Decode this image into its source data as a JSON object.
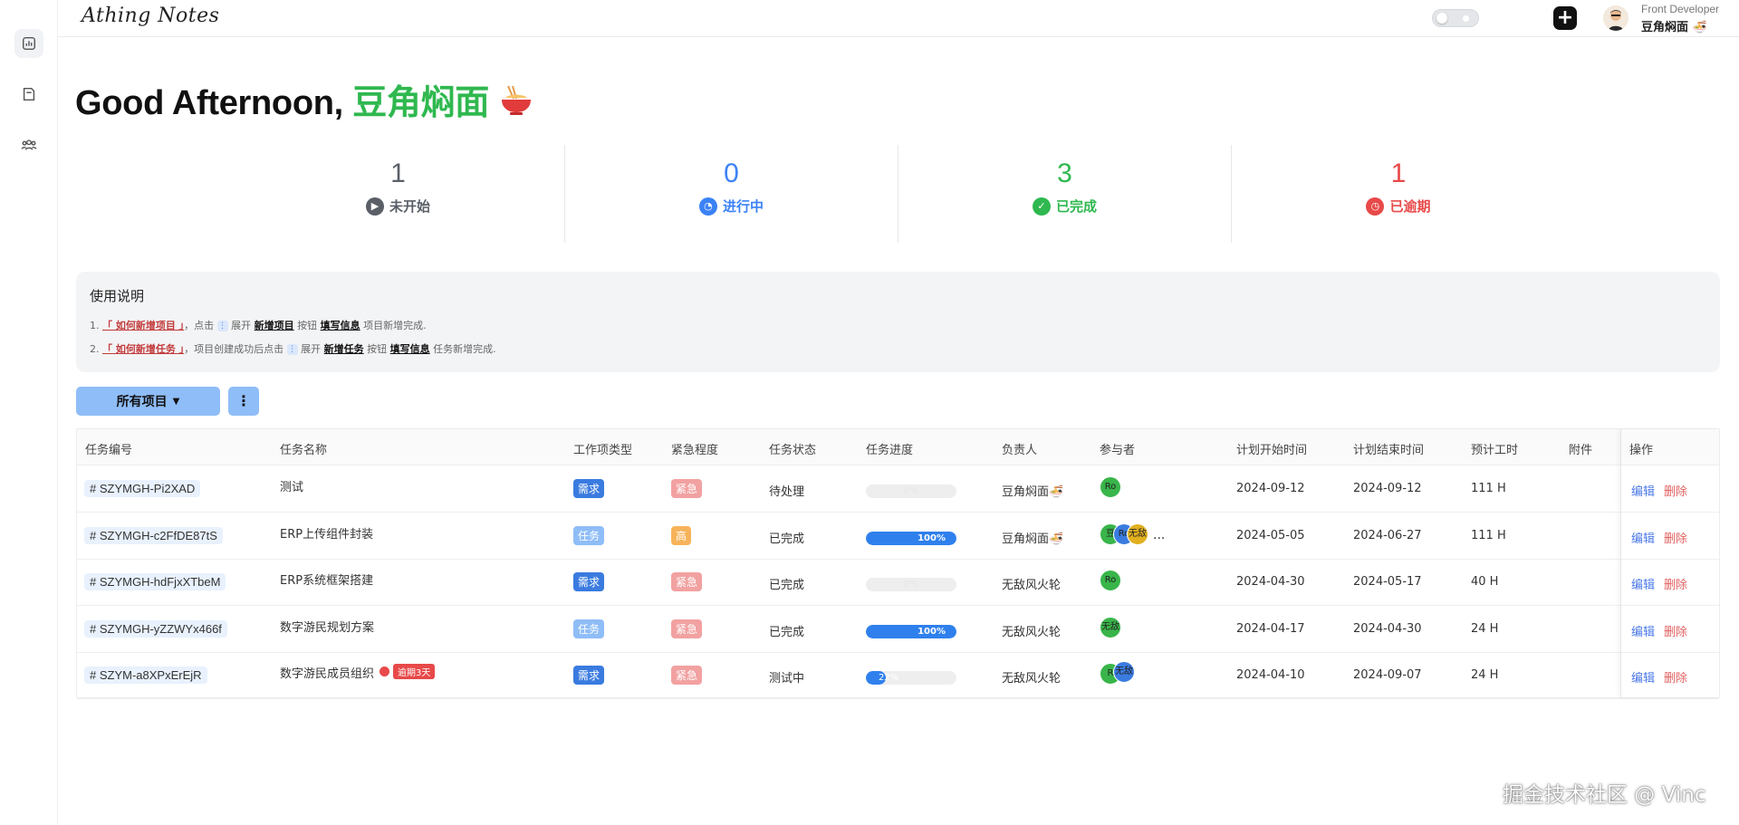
{
  "app": {
    "logo": "Athing Notes"
  },
  "header": {
    "user_role": "Front Developer",
    "user_name": "豆角焖面"
  },
  "greeting": {
    "prefix": "Good Afternoon, ",
    "name": "豆角焖面"
  },
  "stats": [
    {
      "value": "1",
      "label": "未开始",
      "color": "#5a5f67",
      "icon": "play-circle-icon"
    },
    {
      "value": "0",
      "label": "进行中",
      "color": "#3b82f6",
      "icon": "pie-clock-icon"
    },
    {
      "value": "3",
      "label": "已完成",
      "color": "#2fb84f",
      "icon": "check-circle-icon"
    },
    {
      "value": "1",
      "label": "已逾期",
      "color": "#e84949",
      "icon": "clock-alert-icon"
    }
  ],
  "instructions": {
    "title": "使用说明",
    "line1": {
      "num": "1.",
      "link": "「 如何新增项目 」",
      "t1": "，点击",
      "t2": "展开",
      "b1": "新增项目",
      "t3": "按钮",
      "b2": "填写信息",
      "t4": "项目新增完成."
    },
    "line2": {
      "num": "2.",
      "link": "「 如何新增任务 」",
      "t1": "，项目创建成功后点击",
      "t2": "展开",
      "b1": "新增任务",
      "t3": "按钮",
      "b2": "填写信息",
      "t4": "任务新增完成."
    }
  },
  "toolbar": {
    "project_select": "所有项目"
  },
  "table": {
    "headers": {
      "code": "任务编号",
      "name": "任务名称",
      "type": "工作项类型",
      "urgency": "紧急程度",
      "status": "任务状态",
      "progress": "任务进度",
      "owner": "负责人",
      "participants": "参与者",
      "start": "计划开始时间",
      "end": "计划结束时间",
      "hours": "预计工时",
      "attach": "附件",
      "ops": "操作"
    },
    "edit_label": "编辑",
    "delete_label": "删除",
    "rows": [
      {
        "code": "# SZYMGH-Pi2XAD",
        "name": "测试",
        "type": "需求",
        "urgency": "紧急",
        "status": "待处理",
        "progress": "0%",
        "progress_value": 0,
        "owner": "豆角焖面",
        "start": "2024-09-12",
        "end": "2024-09-12",
        "hours": "111 H",
        "avatars": [
          "Ro"
        ]
      },
      {
        "code": "# SZYMGH-c2FfDE87tS",
        "name": "ERP上传组件封装",
        "type": "任务",
        "urgency": "高",
        "status": "已完成",
        "progress": "100%",
        "progress_value": 100,
        "owner": "豆角焖面",
        "start": "2024-05-05",
        "end": "2024-06-27",
        "hours": "111 H",
        "avatars": [
          "豆",
          "Ro",
          "无敌"
        ],
        "more": "..."
      },
      {
        "code": "# SZYMGH-hdFjxXTbeM",
        "name": "ERP系统框架搭建",
        "type": "需求",
        "urgency": "紧急",
        "status": "已完成",
        "progress": "0%",
        "progress_value": 0,
        "owner": "无敌风火轮",
        "start": "2024-04-30",
        "end": "2024-05-17",
        "hours": "40 H",
        "avatars": [
          "Ro"
        ]
      },
      {
        "code": "# SZYMGH-yZZWYx466f",
        "name": "数字游民规划方案",
        "type": "任务",
        "urgency": "紧急",
        "status": "已完成",
        "progress": "100%",
        "progress_value": 100,
        "owner": "无敌风火轮",
        "start": "2024-04-17",
        "end": "2024-04-30",
        "hours": "24 H",
        "avatars": [
          "无敌"
        ]
      },
      {
        "code": "# SZYM-a8XPxErEjR",
        "name": "数字游民成员组织",
        "overdue": "逾期3天",
        "type": "需求",
        "urgency": "紧急",
        "status": "测试中",
        "progress": "22%",
        "progress_value": 22,
        "owner": "无敌风火轮",
        "start": "2024-04-10",
        "end": "2024-09-07",
        "hours": "24 H",
        "avatars": [
          "R",
          "无敌"
        ]
      }
    ]
  },
  "watermark": "掘金技术社区 @ Vinc",
  "colors": {
    "accent_green": "#2fb84f",
    "type_demand": "#3a7be0",
    "type_task": "#8fbdf7",
    "urgency_urgent": "#f2a1a1",
    "urgency_high": "#f7b35a"
  }
}
